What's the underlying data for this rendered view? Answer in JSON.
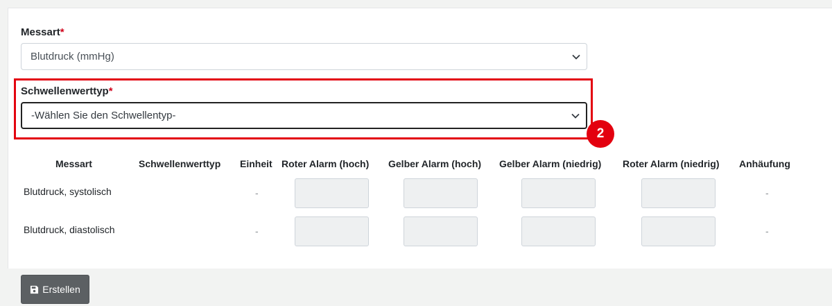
{
  "form": {
    "measurement": {
      "label": "Messart",
      "required_mark": "*",
      "value": "Blutdruck (mmHg)"
    },
    "threshold_type": {
      "label": "Schwellenwerttyp",
      "required_mark": "*",
      "value": "-Wählen Sie den Schwellentyp-"
    }
  },
  "annotation": {
    "step_number": "2",
    "highlight_color": "#e3000f"
  },
  "table": {
    "headers": {
      "messart": "Messart",
      "type": "Schwellenwerttyp",
      "unit": "Einheit",
      "red_high": "Roter Alarm (hoch)",
      "yellow_high": "Gelber Alarm (hoch)",
      "yellow_low": "Gelber Alarm (niedrig)",
      "red_low": "Roter Alarm (niedrig)",
      "accumulation": "Anhäufung"
    },
    "rows": [
      {
        "name": "Blutdruck, systolisch",
        "unit": "-",
        "accumulation": "-"
      },
      {
        "name": "Blutdruck, diastolisch",
        "unit": "-",
        "accumulation": "-"
      }
    ]
  },
  "actions": {
    "create_label": "Erstellen",
    "create_icon": "save-icon"
  },
  "colors": {
    "required": "#d0021b",
    "button_bg": "#5c6063",
    "input_disabled_bg": "#eef0f1"
  }
}
